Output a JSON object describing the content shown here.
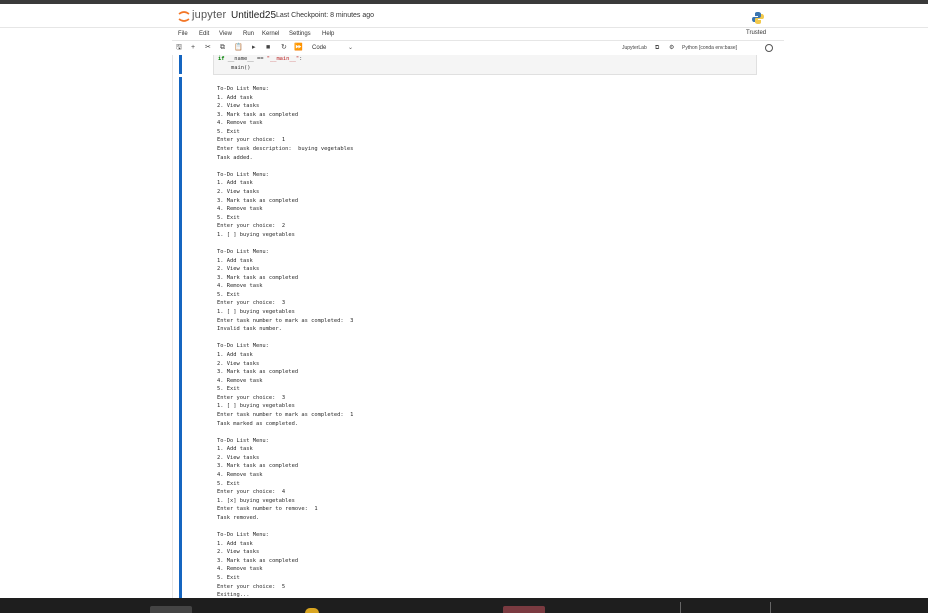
{
  "header": {
    "brand": "jupyter",
    "notebook_name": "Untitled25",
    "checkpoint": "Last Checkpoint: 8 minutes ago",
    "trusted": "Trusted"
  },
  "menu": {
    "items": [
      "File",
      "Edit",
      "View",
      "Run",
      "Kernel",
      "Settings",
      "Help"
    ]
  },
  "toolbar": {
    "save": "🖫",
    "add": "+",
    "cut": "✂",
    "copy": "⧉",
    "paste": "📋",
    "run": "▸",
    "stop": "■",
    "restart": "↻",
    "run_all": "⏩",
    "cell_type": "Code",
    "chevron": "⌄",
    "jupyterlab": "JupyterLab",
    "kernel": "Python [conda env:base]"
  },
  "cells": {
    "code_line1_a": "if ",
    "code_line1_b": "__name__ == ",
    "code_line1_c": "\"__main__\"",
    "code_line1_d": ":",
    "code_line2": "    main()",
    "output_lines": [
      "To-Do List Menu:",
      "1. Add task",
      "2. View tasks",
      "3. Mark task as completed",
      "4. Remove task",
      "5. Exit",
      "Enter your choice:  1",
      "Enter task description:  buying vegetables",
      "Task added.",
      "",
      "To-Do List Menu:",
      "1. Add task",
      "2. View tasks",
      "3. Mark task as completed",
      "4. Remove task",
      "5. Exit",
      "Enter your choice:  2",
      "1. [ ] buying vegetables",
      "",
      "To-Do List Menu:",
      "1. Add task",
      "2. View tasks",
      "3. Mark task as completed",
      "4. Remove task",
      "5. Exit",
      "Enter your choice:  3",
      "1. [ ] buying vegetables",
      "Enter task number to mark as completed:  3",
      "Invalid task number.",
      "",
      "To-Do List Menu:",
      "1. Add task",
      "2. View tasks",
      "3. Mark task as completed",
      "4. Remove task",
      "5. Exit",
      "Enter your choice:  3",
      "1. [ ] buying vegetables",
      "Enter task number to mark as completed:  1",
      "Task marked as completed.",
      "",
      "To-Do List Menu:",
      "1. Add task",
      "2. View tasks",
      "3. Mark task as completed",
      "4. Remove task",
      "5. Exit",
      "Enter your choice:  4",
      "1. [x] buying vegetables",
      "Enter task number to remove:  1",
      "Task removed.",
      "",
      "To-Do List Menu:",
      "1. Add task",
      "2. View tasks",
      "3. Mark task as completed",
      "4. Remove task",
      "5. Exit",
      "Enter your choice:  5",
      "Exiting..."
    ]
  },
  "colors": {
    "accent": "#1565c0",
    "jupyter_orange": "#f37626",
    "keyword": "#008000",
    "string": "#ba2121"
  }
}
